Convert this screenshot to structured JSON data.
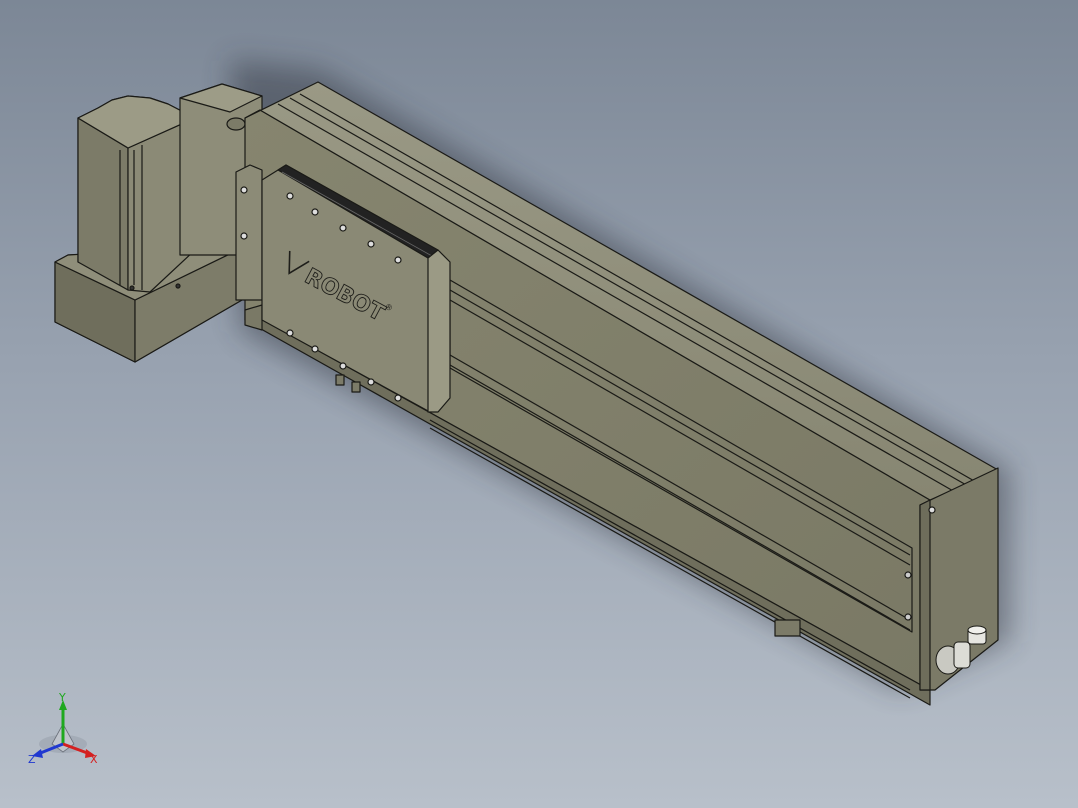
{
  "viewport": {
    "background_top": "#7c8796",
    "background_bottom": "#b8c0ca"
  },
  "model": {
    "part_color": "#8b8a76",
    "edge_color": "#1a1a16",
    "carriage_logo": "ROBOT",
    "carriage_logo_mark": "registered-mark-icon"
  },
  "triad": {
    "x_label": "X",
    "y_label": "Y",
    "z_label": "Z",
    "x_color": "#d42020",
    "y_color": "#1fa81f",
    "z_color": "#2038d0"
  }
}
